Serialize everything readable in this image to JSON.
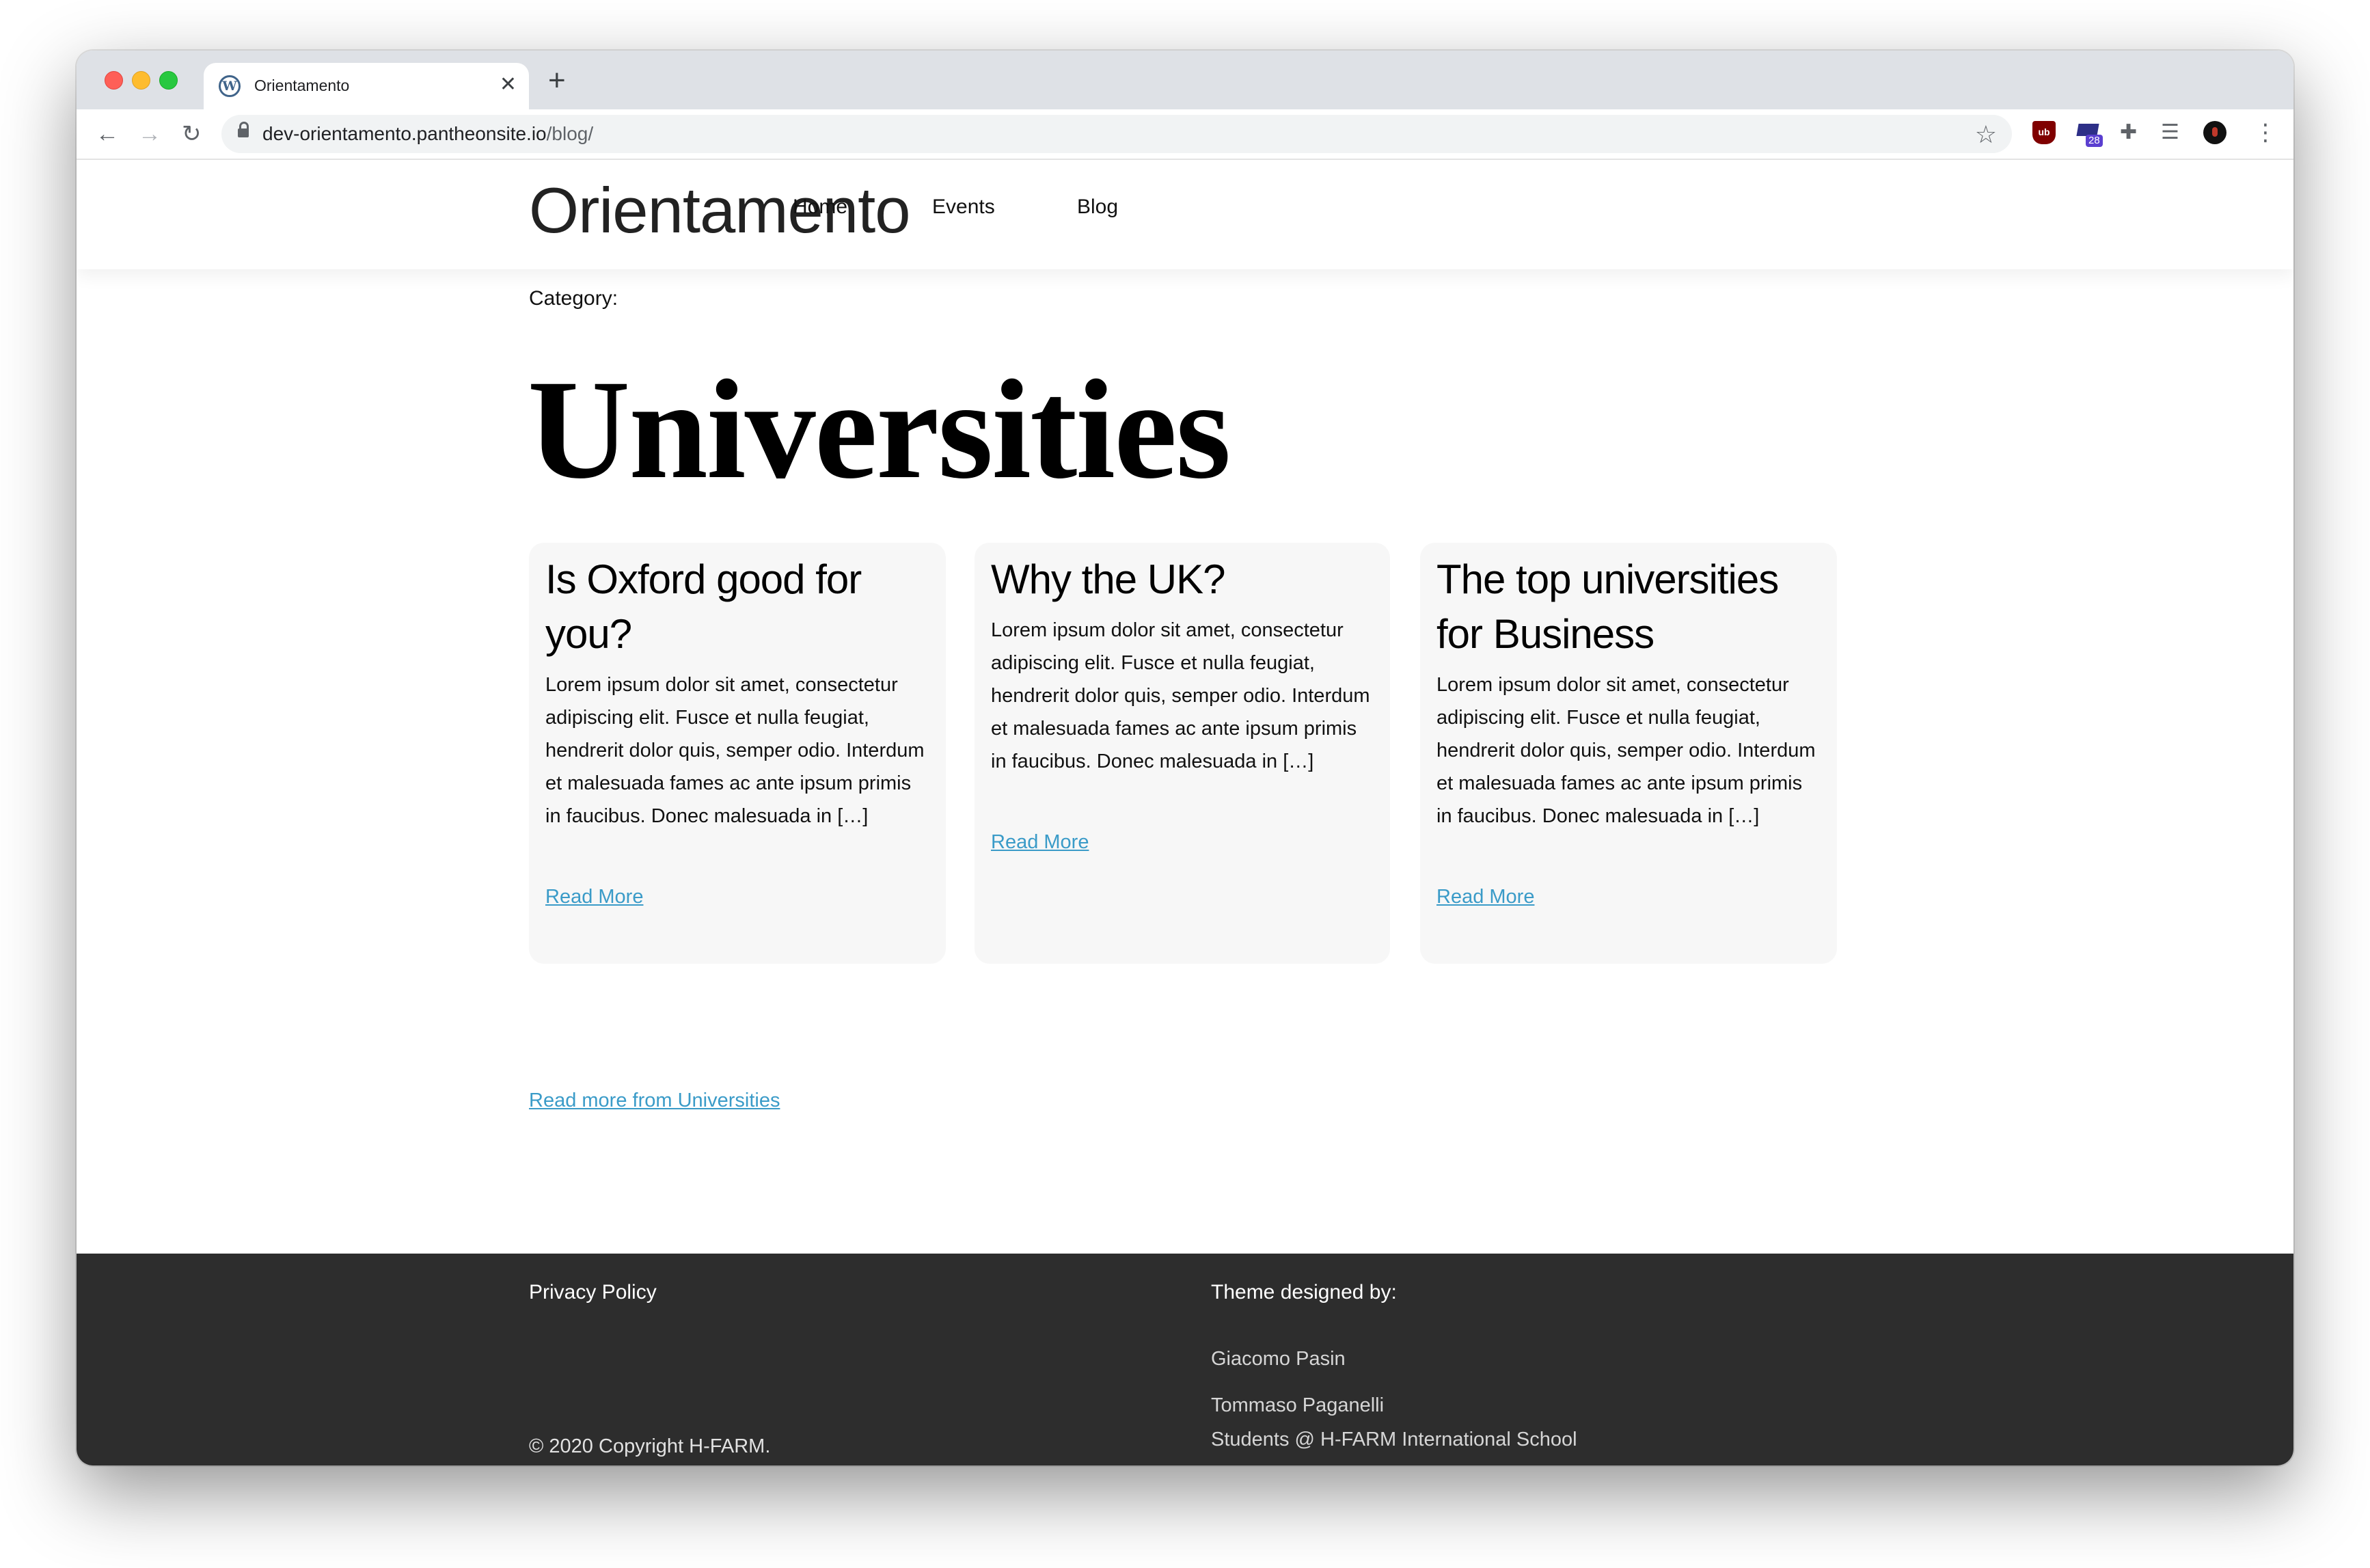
{
  "browser": {
    "tab_title": "Orientamento",
    "url_host": "dev-orientamento.pantheonsite.io",
    "url_path": "/blog/",
    "extension_badge": "28"
  },
  "site": {
    "title": "Orientamento",
    "nav": [
      "Home",
      "Events",
      "Blog"
    ]
  },
  "category": {
    "label": "Category:",
    "title": "Universities"
  },
  "posts": [
    {
      "title": "Is Oxford good for you?",
      "excerpt": "Lorem ipsum dolor sit amet, consectetur adipiscing elit. Fusce et nulla feugiat, hendrerit dolor quis, semper odio. Interdum et malesuada fames ac ante ipsum primis in faucibus. Donec malesuada in […]",
      "read_more": "Read More"
    },
    {
      "title": "Why the UK?",
      "excerpt": "Lorem ipsum dolor sit amet, consectetur adipiscing elit. Fusce et nulla feugiat, hendrerit dolor quis, semper odio. Interdum et malesuada fames ac ante ipsum primis in faucibus. Donec malesuada in […]",
      "read_more": "Read More"
    },
    {
      "title": "The top universities for Business",
      "excerpt": "Lorem ipsum dolor sit amet, consectetur adipiscing elit. Fusce et nulla feugiat, hendrerit dolor quis, semper odio. Interdum et malesuada fames ac ante ipsum primis in faucibus. Donec malesuada in […]",
      "read_more": "Read More"
    }
  ],
  "more_link": "Read more from Universities",
  "footer": {
    "privacy": "Privacy Policy",
    "copyright": "© 2020 Copyright H-FARM.",
    "theme_label": "Theme designed by:",
    "designers": [
      "Giacomo Pasin",
      "Tommaso Paganelli"
    ],
    "school": "Students @ H-FARM International School"
  },
  "colors": {
    "link": "#3a9bc8",
    "footer_bg": "#2d2d2d",
    "card_bg": "#f7f7f7"
  }
}
